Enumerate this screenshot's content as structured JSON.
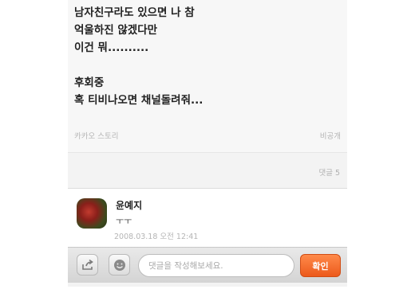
{
  "post": {
    "text": "남자친구라도 있으면 나 참\n억울하진 않겠다만\n이건 뭐..........\n\n후회중\n혹 티비나오면 채널돌려줘...",
    "source": "카카오 스토리",
    "visibility": "비공개"
  },
  "comment_count_label": "댓글 5",
  "comment": {
    "author": "윤예지",
    "body": "ㅜㅜ",
    "timestamp": "2008.03.18 오전 12:41"
  },
  "input_bar": {
    "placeholder": "댓글을 작성해보세요.",
    "confirm_label": "확인",
    "share_icon": "share-icon",
    "emoticon_icon": "emoticon-icon"
  },
  "colors": {
    "accent": "#f26b2a",
    "background": "#f3f3f3"
  }
}
